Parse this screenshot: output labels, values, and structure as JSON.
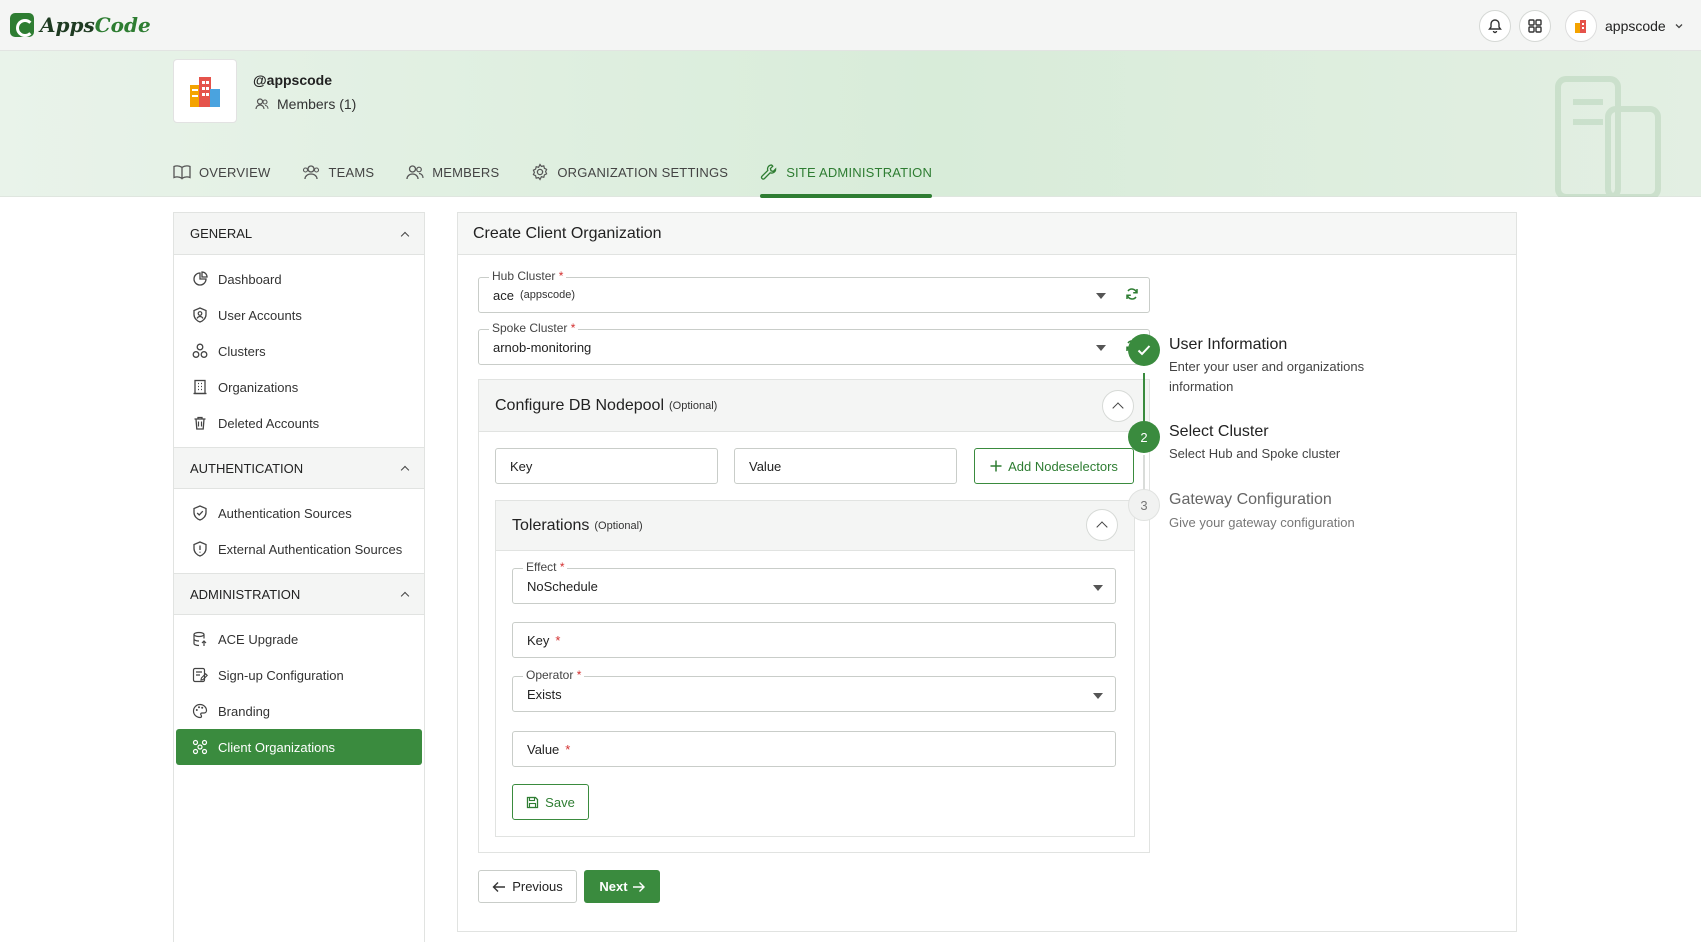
{
  "app": {
    "brand_prefix": "Apps",
    "brand_suffix": "Code"
  },
  "topbar": {
    "user_name": "appscode"
  },
  "org": {
    "handle": "@appscode",
    "members": "Members (1)"
  },
  "tabs": [
    {
      "label": "OVERVIEW",
      "icon": "book-icon"
    },
    {
      "label": "TEAMS",
      "icon": "team-icon"
    },
    {
      "label": "MEMBERS",
      "icon": "members-icon"
    },
    {
      "label": "ORGANIZATION SETTINGS",
      "icon": "gear-icon"
    },
    {
      "label": "SITE ADMINISTRATION",
      "icon": "wrench-icon",
      "active": true
    }
  ],
  "sidebar": {
    "general": {
      "title": "GENERAL",
      "items": [
        "Dashboard",
        "User Accounts",
        "Clusters",
        "Organizations",
        "Deleted Accounts"
      ]
    },
    "authentication": {
      "title": "AUTHENTICATION",
      "items": [
        "Authentication Sources",
        "External Authentication Sources"
      ]
    },
    "administration": {
      "title": "ADMINISTRATION",
      "items": [
        "ACE Upgrade",
        "Sign-up Configuration",
        "Branding",
        "Client Organizations"
      ]
    }
  },
  "main": {
    "title": "Create Client Organization",
    "hub_cluster": {
      "label": "Hub Cluster",
      "value": "ace",
      "sub": "(appscode)"
    },
    "spoke_cluster": {
      "label": "Spoke Cluster",
      "value": "arnob-monitoring"
    },
    "nodepool": {
      "title": "Configure DB Nodepool",
      "optional": "(Optional)",
      "key_placeholder": "Key",
      "value_placeholder": "Value",
      "add_label": "Add Nodeselectors"
    },
    "tolerations": {
      "title": "Tolerations",
      "optional": "(Optional)",
      "effect_label": "Effect",
      "effect_value": "NoSchedule",
      "key_label": "Key",
      "operator_label": "Operator",
      "operator_value": "Exists",
      "value_label": "Value",
      "save_label": "Save"
    },
    "previous_label": "Previous",
    "next_label": "Next",
    "required_mark": "*"
  },
  "stepper": [
    {
      "number": "1",
      "title": "User Information",
      "desc": "Enter your user and organizations information",
      "state": "done"
    },
    {
      "number": "2",
      "title": "Select Cluster",
      "desc": "Select Hub and Spoke cluster",
      "state": "current"
    },
    {
      "number": "3",
      "title": "Gateway Configuration",
      "desc": "Give your gateway configuration",
      "state": "todo"
    }
  ],
  "colors": {
    "accent": "#3a8b3e",
    "required": "#d32f2f",
    "banner": "#d8ecd9"
  }
}
